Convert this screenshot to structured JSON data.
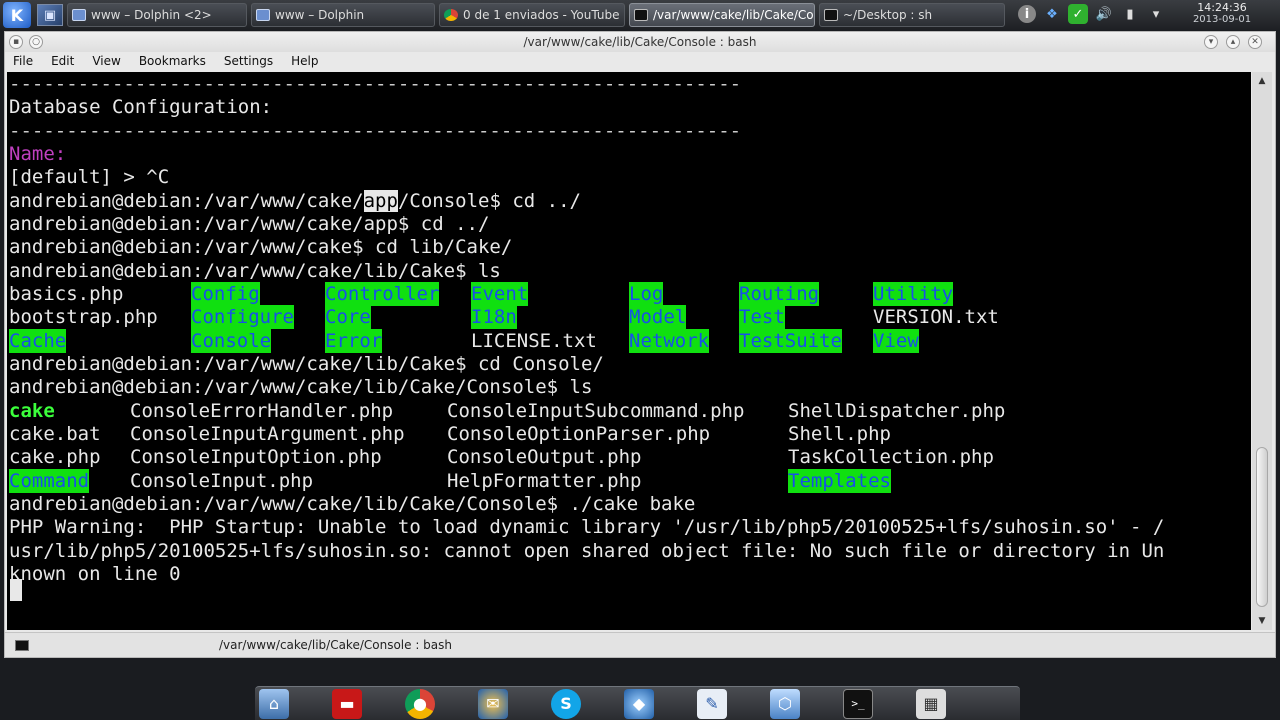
{
  "taskbar": {
    "tasks": [
      {
        "label": "www – Dolphin <2>",
        "icon": "dolphin-icon"
      },
      {
        "label": "www – Dolphin",
        "icon": "dolphin-icon"
      },
      {
        "label": "0 de 1 enviados - YouTube",
        "icon": "chrome-icon"
      },
      {
        "label": "/var/www/cake/lib/Cake/Con",
        "icon": "terminal-icon"
      },
      {
        "label": "~/Desktop : sh",
        "icon": "terminal-icon"
      }
    ],
    "clock": {
      "time": "14:24:36",
      "date": "2013-09-01"
    }
  },
  "window": {
    "title": "/var/www/cake/lib/Cake/Console : bash",
    "menu": [
      "File",
      "Edit",
      "View",
      "Bookmarks",
      "Settings",
      "Help"
    ],
    "tab_label": "/var/www/cake/lib/Cake/Console : bash"
  },
  "terminal": {
    "dash_line": "----------------------------------------------------------------",
    "db_config": "Database Configuration:",
    "name_prompt": "Name:",
    "default_line": "[default] > ^C",
    "cmd1_pre": "andrebian@debian:/var/www/cake/",
    "cmd1_sel": "app",
    "cmd1_post": "/Console$ cd ../",
    "cmd2": "andrebian@debian:/var/www/cake/app$ cd ../",
    "cmd3": "andrebian@debian:/var/www/cake$ cd lib/Cake/",
    "cmd4": "andrebian@debian:/var/www/cake/lib/Cake$ ls",
    "cake_ls": [
      [
        "basics.php",
        "Config",
        "Controller",
        "Event",
        "Log",
        "Routing",
        "Utility"
      ],
      [
        "bootstrap.php",
        "Configure",
        "Core",
        "I18n",
        "Model",
        "Test",
        "VERSION.txt"
      ],
      [
        "Cache",
        "Console",
        "Error",
        "LICENSE.txt",
        "Network",
        "TestSuite",
        "View"
      ]
    ],
    "cmd5": "andrebian@debian:/var/www/cake/lib/Cake$ cd Console/",
    "cmd6": "andrebian@debian:/var/www/cake/lib/Cake/Console$ ls",
    "console_ls": [
      [
        "cake",
        "ConsoleErrorHandler.php",
        "ConsoleInputSubcommand.php",
        "ShellDispatcher.php"
      ],
      [
        "cake.bat",
        "ConsoleInputArgument.php",
        "ConsoleOptionParser.php",
        "Shell.php"
      ],
      [
        "cake.php",
        "ConsoleInputOption.php",
        "ConsoleOutput.php",
        "TaskCollection.php"
      ],
      [
        "Command",
        "ConsoleInput.php",
        "HelpFormatter.php",
        "Templates"
      ]
    ],
    "cmd7": "andrebian@debian:/var/www/cake/lib/Cake/Console$ ./cake bake",
    "warn1": "PHP Warning:  PHP Startup: Unable to load dynamic library '/usr/lib/php5/20100525+lfs/suhosin.so' - /",
    "warn2": "usr/lib/php5/20100525+lfs/suhosin.so: cannot open shared object file: No such file or directory in Un",
    "warn3": "known on line 0"
  },
  "dock": [
    "system-settings-icon",
    "files-icon",
    "chrome-icon",
    "thunderbird-icon",
    "skype-icon",
    "netbeans-icon",
    "editor-icon",
    "virtualbox-icon",
    "terminal-icon",
    "calculator-icon"
  ]
}
